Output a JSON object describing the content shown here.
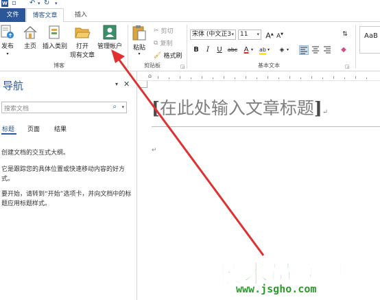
{
  "qat": {
    "app_icon": "word-app-icon",
    "items": [
      {
        "name": "save-icon",
        "glyph": "▫"
      },
      {
        "name": "undo-icon",
        "glyph": "↶"
      },
      {
        "name": "undo-dropdown-icon",
        "glyph": "▾"
      },
      {
        "name": "redo-icon",
        "glyph": "↻"
      },
      {
        "name": "customize-qat-icon",
        "glyph": "▾"
      }
    ]
  },
  "tabs": {
    "file": "文件",
    "blog": "博客文章",
    "insert": "插入"
  },
  "ribbon": {
    "blog_group": {
      "publish": "发布",
      "home": "主页",
      "insert_category": "插入类别",
      "open_existing_line1": "打开",
      "open_existing_line2": "现有文章",
      "manage_accounts": "管理帐户",
      "label": "博客"
    },
    "clipboard": {
      "paste": "粘贴",
      "cut": "剪切",
      "copy": "复制",
      "format_painter": "格式刷",
      "label": "剪贴板"
    },
    "basic_text": {
      "font_name": "宋体 (中文正3",
      "font_size": "11",
      "grow_font": "A",
      "shrink_font": "A",
      "bold": "B",
      "italic": "I",
      "underline": "U",
      "strikethrough": "abc",
      "font_color": "A",
      "highlight": "ab",
      "label": "基本文本"
    },
    "styles": {
      "preview": "AaB"
    }
  },
  "navigation": {
    "title": "导航",
    "dropdown_glyph": "▾",
    "close_glyph": "✕",
    "search_placeholder": "搜索文档",
    "tabs": [
      "标题",
      "页面",
      "结果"
    ],
    "active_tab": 0,
    "paragraphs": [
      "创建文档的交互式大纲。",
      "它是跟踪您的具体位置或快速移动内容的好方式。",
      "要开始，请转到“开始”选项卡，并向文档中的标题应用标题样式。"
    ]
  },
  "document": {
    "title_placeholder": "在此处输入文章标题",
    "open_bracket": "[",
    "close_bracket": "]",
    "paragraph_mark": "↵"
  },
  "watermark": {
    "cn": "技术员联盟",
    "url": "www.jsgho.com"
  },
  "colors": {
    "accent": "#2b579a",
    "arrow": "#e03030",
    "watermark": "#3aa33a"
  }
}
